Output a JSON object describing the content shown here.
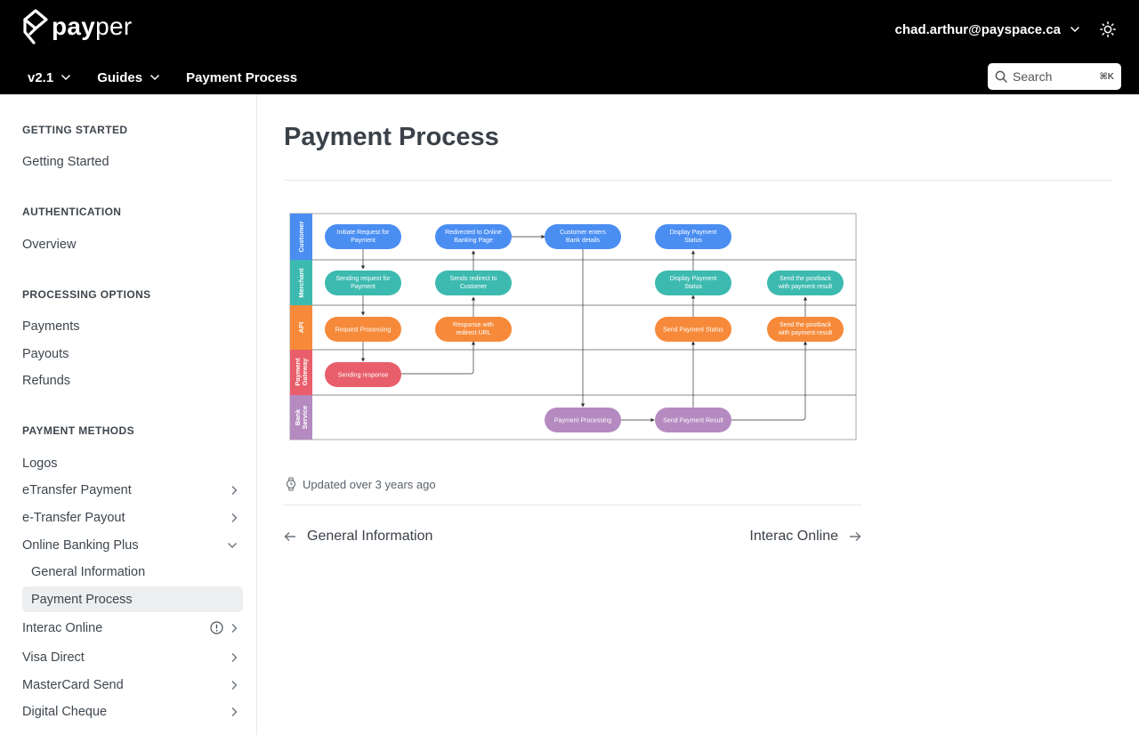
{
  "brand": {
    "logo_bold": "pay",
    "logo_regular": "per"
  },
  "header": {
    "user_email": "chad.arthur@payspace.ca",
    "version": "v2.1",
    "guides": "Guides",
    "current_page": "Payment Process",
    "search_placeholder": "Search",
    "search_shortcut": "⌘K"
  },
  "sidebar": {
    "sections": [
      {
        "title": "GETTING STARTED",
        "items": [
          {
            "label": "Getting Started"
          }
        ]
      },
      {
        "title": "AUTHENTICATION",
        "items": [
          {
            "label": "Overview"
          }
        ]
      },
      {
        "title": "PROCESSING OPTIONS",
        "items": [
          {
            "label": "Payments"
          },
          {
            "label": "Payouts"
          },
          {
            "label": "Refunds"
          }
        ]
      },
      {
        "title": "PAYMENT METHODS",
        "items": [
          {
            "label": "Logos"
          },
          {
            "label": "eTransfer Payment"
          },
          {
            "label": "e-Transfer Payout"
          },
          {
            "label": "Online Banking Plus"
          },
          {
            "label": "General Information"
          },
          {
            "label": "Payment Process"
          },
          {
            "label": "Interac Online"
          },
          {
            "label": "Visa Direct"
          },
          {
            "label": "MasterCard Send"
          },
          {
            "label": "Digital Cheque"
          }
        ]
      }
    ]
  },
  "main": {
    "title": "Payment Process",
    "updated": "Updated over 3 years ago",
    "prev_label": "General Information",
    "next_label": "Interac Online"
  },
  "diagram": {
    "lanes": [
      {
        "name": "Customer",
        "color": "#4a8ef2"
      },
      {
        "name": "Merchant",
        "color": "#3dbab0"
      },
      {
        "name": "API",
        "color": "#f68a3a"
      },
      {
        "name": "Payment Gateway",
        "color": "#e85e6a"
      },
      {
        "name": "Bank Service",
        "color": "#b58ac1"
      }
    ],
    "nodes": {
      "initiate": "Initiate Request for Payment",
      "redirected": "Redirected to Online Banking Page",
      "enters": "Customer enters Bank details",
      "display_c": "Display Payment Status",
      "sending_req": "Sending request for Payment",
      "sends_redirect": "Sends redirect to Customer",
      "display_m": "Display Payment Status",
      "postback_m": "Send the postback with payment result",
      "req_processing": "Request Processing",
      "response_url": "Response with redirect URL",
      "send_status": "Send Payment Status",
      "postback_a": "Send the postback with payment result",
      "sending_response": "Sending response",
      "pay_processing": "Payment Processing",
      "send_result": "Send Payment Result"
    }
  }
}
